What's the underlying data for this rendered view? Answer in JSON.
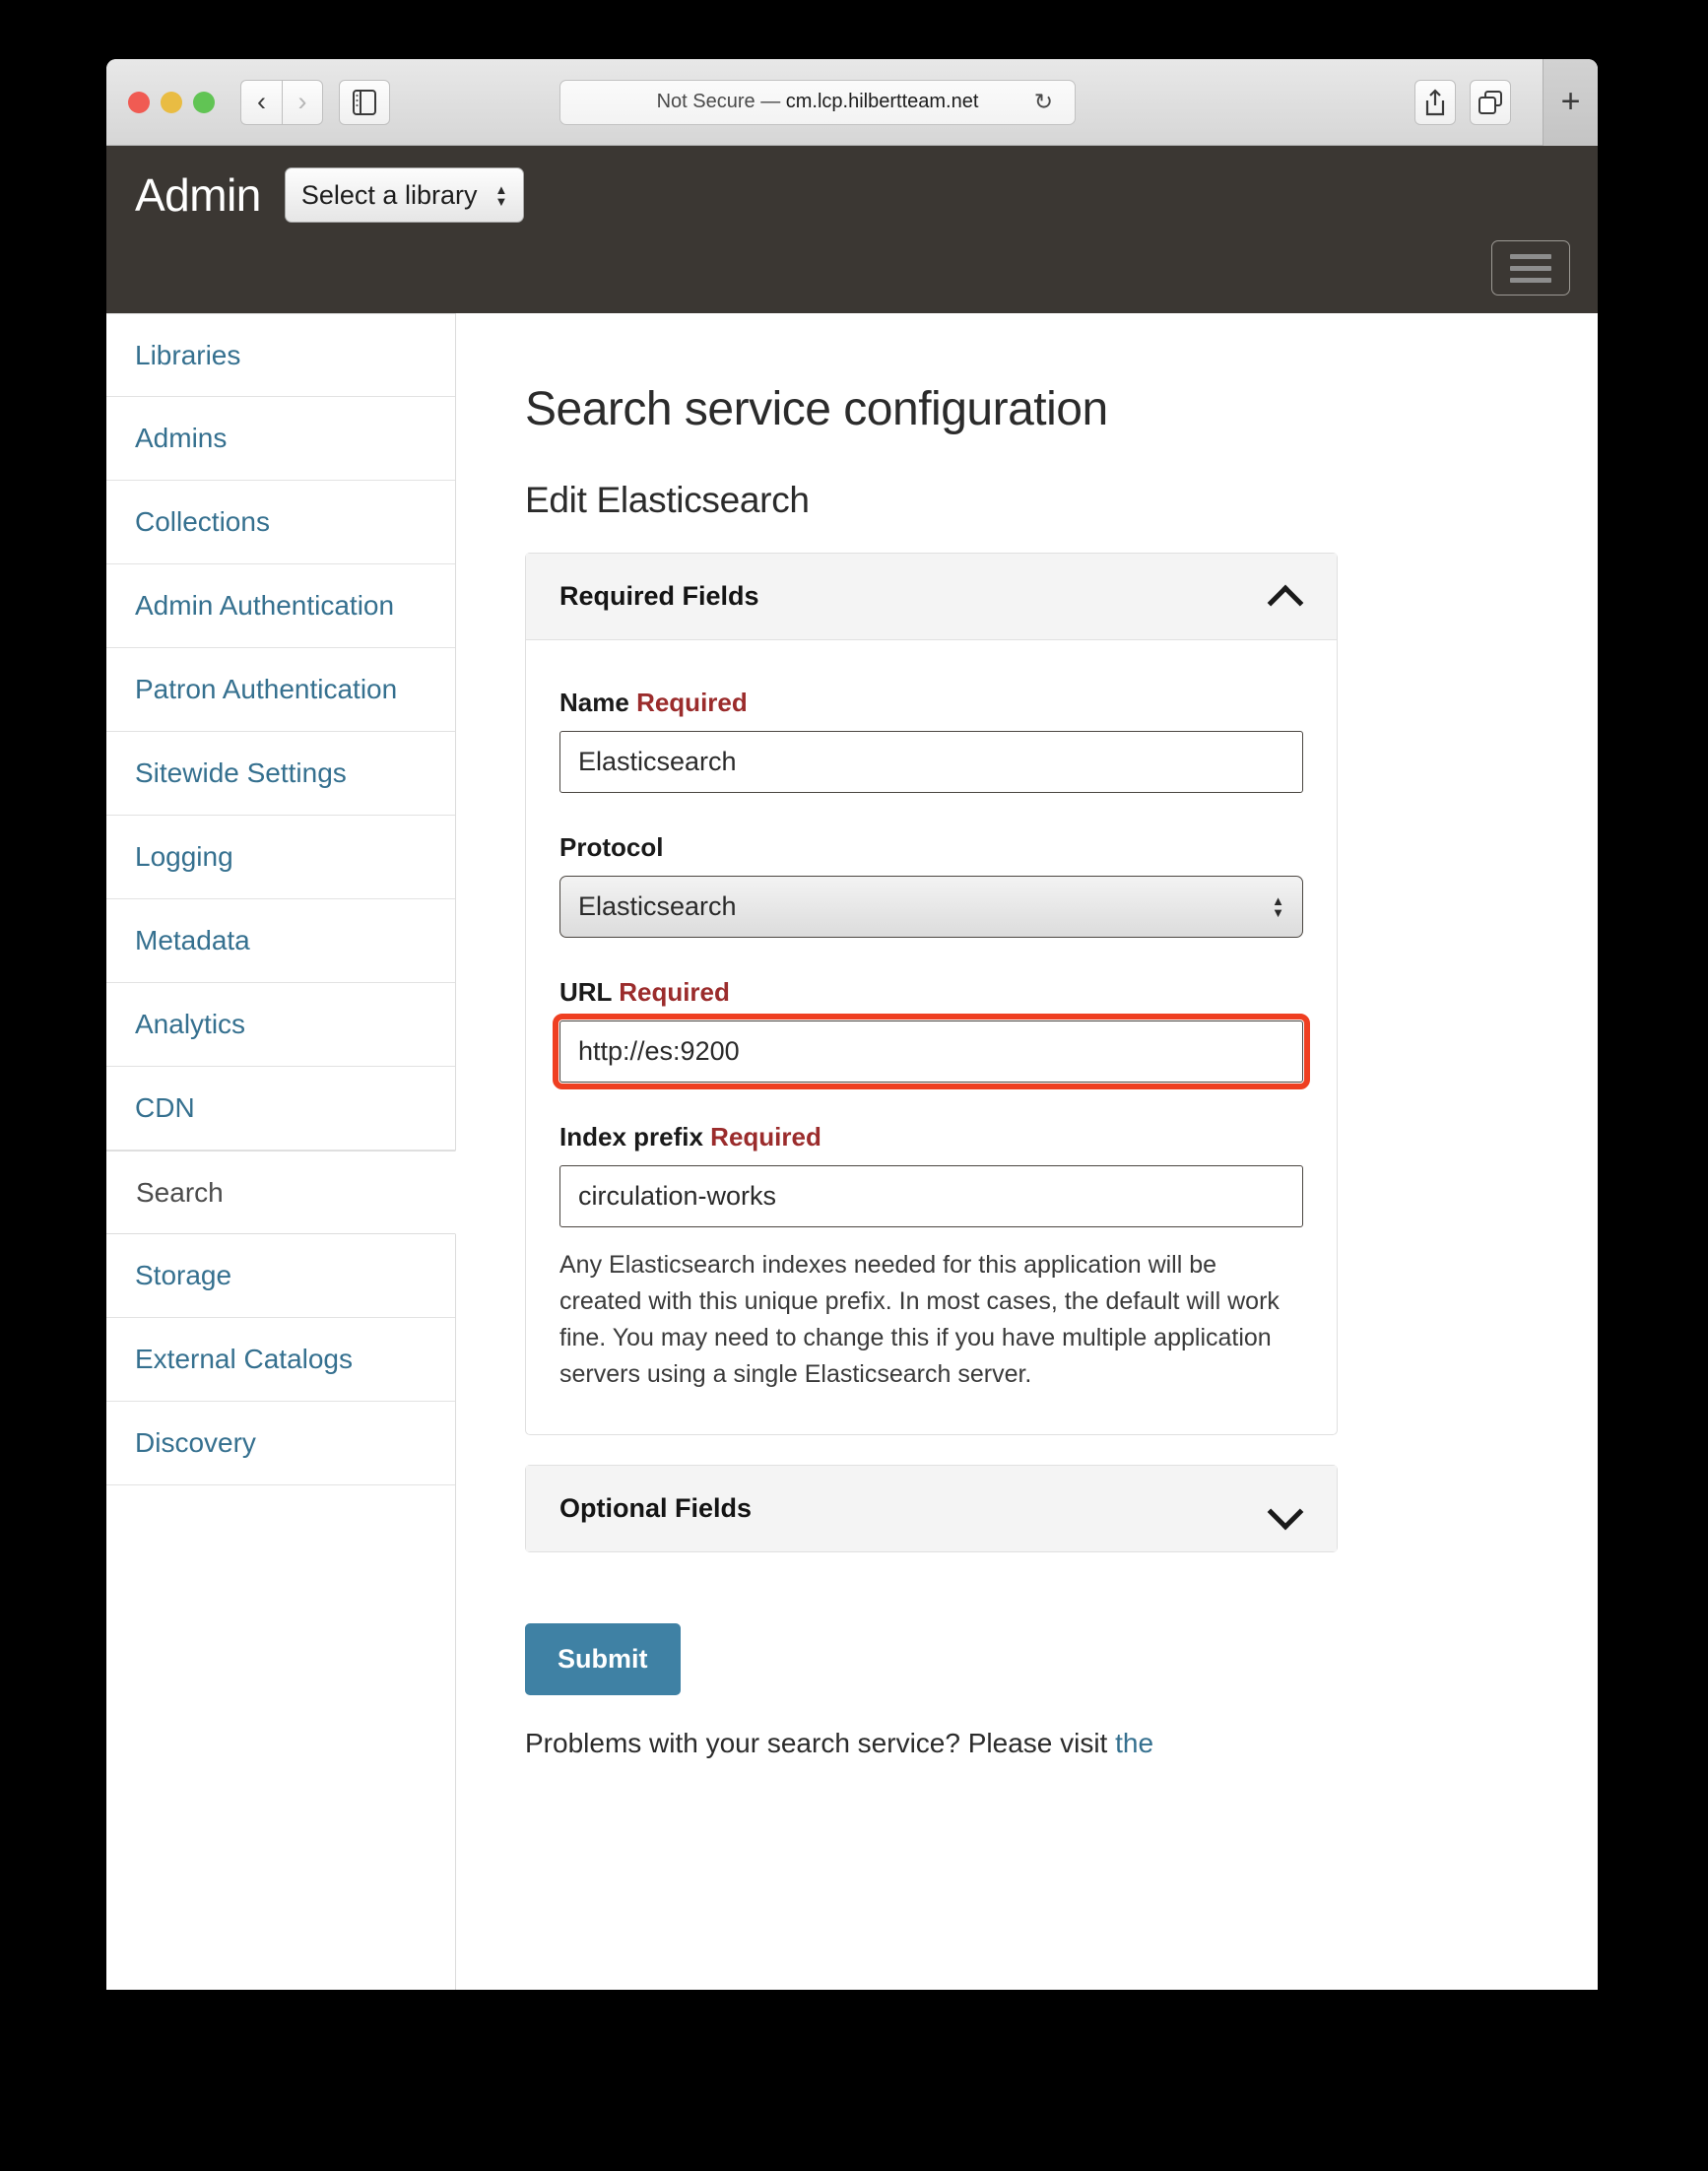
{
  "browser": {
    "url_prefix": "Not Secure — ",
    "url_host": "cm.lcp.hilbertteam.net",
    "back_icon": "‹",
    "forward_icon": "›",
    "reload_icon": "↻",
    "newtab_icon": "+"
  },
  "header": {
    "brand": "Admin",
    "library_select_value": "Select a library"
  },
  "sidebar": {
    "items": [
      {
        "label": "Libraries",
        "active": false
      },
      {
        "label": "Admins",
        "active": false
      },
      {
        "label": "Collections",
        "active": false
      },
      {
        "label": "Admin Authentication",
        "active": false
      },
      {
        "label": "Patron Authentication",
        "active": false
      },
      {
        "label": "Sitewide Settings",
        "active": false
      },
      {
        "label": "Logging",
        "active": false
      },
      {
        "label": "Metadata",
        "active": false
      },
      {
        "label": "Analytics",
        "active": false
      },
      {
        "label": "CDN",
        "active": false
      },
      {
        "label": "Search",
        "active": true
      },
      {
        "label": "Storage",
        "active": false
      },
      {
        "label": "External Catalogs",
        "active": false
      },
      {
        "label": "Discovery",
        "active": false
      }
    ]
  },
  "main": {
    "page_title": "Search service configuration",
    "section_title": "Edit Elasticsearch",
    "required_panel": {
      "title": "Required Fields",
      "expanded": true
    },
    "optional_panel": {
      "title": "Optional Fields",
      "expanded": false
    },
    "fields": {
      "name": {
        "label": "Name",
        "required_tag": "Required",
        "value": "Elasticsearch"
      },
      "protocol": {
        "label": "Protocol",
        "value": "Elasticsearch"
      },
      "url": {
        "label": "URL",
        "required_tag": "Required",
        "value": "http://es:9200",
        "highlighted": true
      },
      "index_prefix": {
        "label": "Index prefix",
        "required_tag": "Required",
        "value": "circulation-works",
        "help": "Any Elasticsearch indexes needed for this application will be created with this unique prefix. In most cases, the default will work fine. You may need to change this if you have multiple application servers using a single Elasticsearch server."
      }
    },
    "submit_label": "Submit",
    "footer_text": "Problems with your search service? Please visit ",
    "footer_link": "the"
  },
  "colors": {
    "header_bg": "#3b3733",
    "link": "#35708f",
    "required_red": "#9b2c2c",
    "highlight_red": "#ef3f21",
    "submit_blue": "#3f81a4"
  }
}
